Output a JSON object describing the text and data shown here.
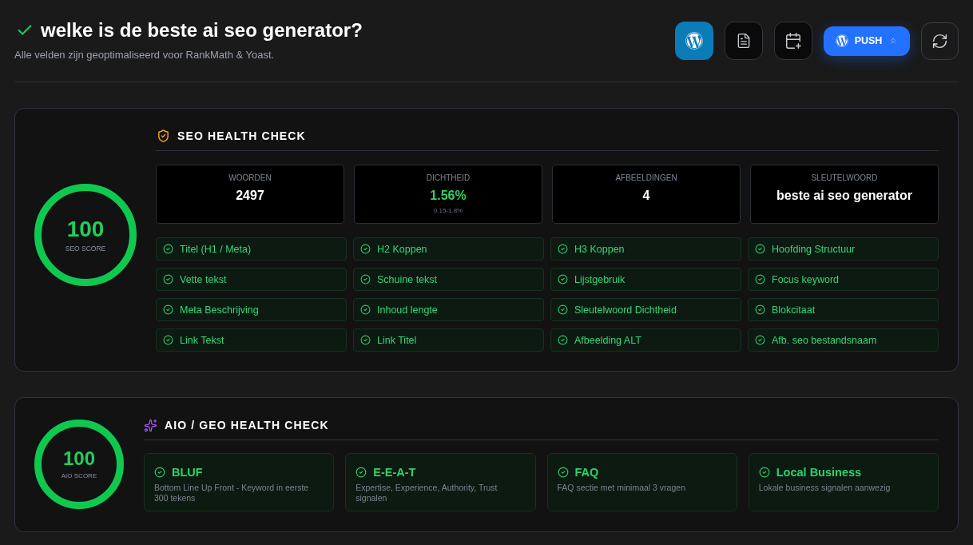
{
  "header": {
    "title": "welke is de beste ai seo generator?",
    "subtitle": "Alle velden zijn geoptimaliseerd voor RankMath & Yoast."
  },
  "toolbar": [
    {
      "kind": "wordpress"
    },
    {
      "kind": "document"
    },
    {
      "kind": "schedule"
    },
    {
      "kind": "push",
      "label": "PUSH"
    },
    {
      "kind": "refresh"
    }
  ],
  "seo_health": {
    "title": "SEO HEALTH CHECK",
    "score": "100",
    "score_label": "SEO SCORE",
    "level": 1,
    "stats": [
      {
        "label": "WOORDEN",
        "value": "2497",
        "highlight": false
      },
      {
        "label": "DICHTHEID",
        "value": "1.56%",
        "note": "0.15-1.8%",
        "highlight": true
      },
      {
        "label": "AFBEELDINGEN",
        "value": "4",
        "highlight": false
      },
      {
        "label": "SLEUTELWOORD",
        "value": "beste ai seo generator",
        "highlight": false
      }
    ],
    "checks": [
      {
        "label": "Titel (H1 / Meta)",
        "passed": true
      },
      {
        "label": "H2 Koppen",
        "passed": true
      },
      {
        "label": "H3 Koppen",
        "passed": true
      },
      {
        "label": "Hoofding Structuur",
        "passed": true
      },
      {
        "label": "Vette tekst",
        "passed": true
      },
      {
        "label": "Schuine tekst",
        "passed": true
      },
      {
        "label": "Lijstgebruik",
        "passed": true
      },
      {
        "label": "Focus keyword",
        "passed": true
      },
      {
        "label": "Meta Beschrijving",
        "passed": true
      },
      {
        "label": "Inhoud lengte",
        "passed": true
      },
      {
        "label": "Sleutelwoord Dichtheid",
        "passed": true
      },
      {
        "label": "Blokcitaat",
        "passed": true
      },
      {
        "label": "Link Tekst",
        "passed": true
      },
      {
        "label": "Link Titel",
        "passed": true
      },
      {
        "label": "Afbeelding ALT",
        "passed": true
      },
      {
        "label": "Afb. seo bestandsnaam",
        "passed": true
      }
    ]
  },
  "aio_health": {
    "title": "AIO / GEO HEALTH CHECK",
    "score": "100",
    "score_label": "AIO SCORE",
    "level": 1,
    "checks": [
      {
        "title": "BLUF",
        "description": "Bottom Line Up Front - Keyword in eerste 300 tekens",
        "passed": true
      },
      {
        "title": "E-E-A-T",
        "description": "Expertise, Experience, Authority, Trust signalen",
        "passed": true
      },
      {
        "title": "FAQ",
        "description": "FAQ sectie met minimaal 3 vragen",
        "passed": true
      },
      {
        "title": "Local Business",
        "description": "Lokale business signalen aanwezig",
        "passed": true
      }
    ]
  }
}
